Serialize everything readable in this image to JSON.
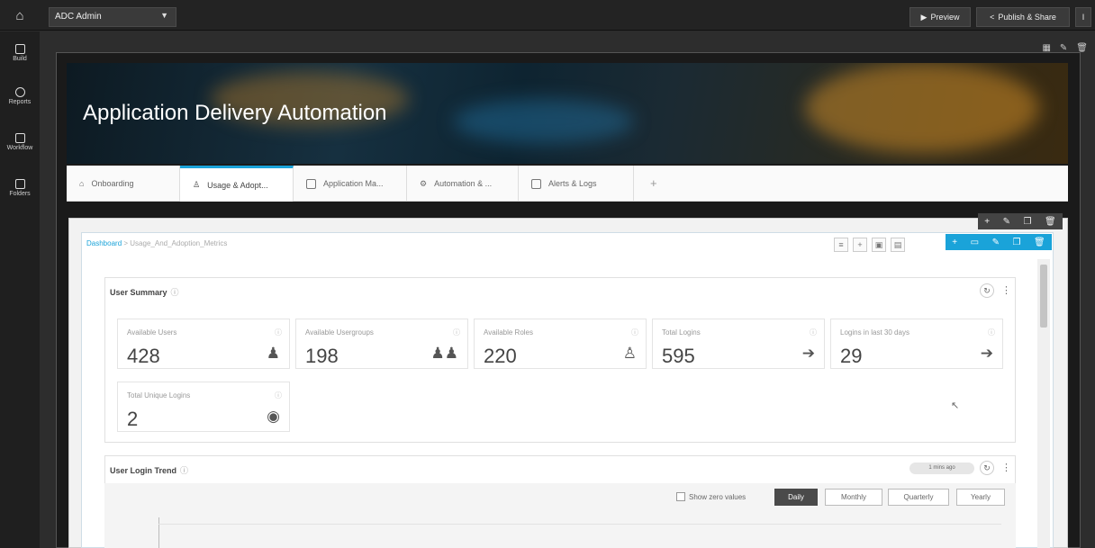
{
  "topbar": {
    "app_name": "ADC Admin",
    "preview_label": "Preview",
    "publish_label": "Publish & Share"
  },
  "sidebar": {
    "items": [
      {
        "label": "Build",
        "icon": "build-icon"
      },
      {
        "label": "Reports",
        "icon": "reports-icon"
      },
      {
        "label": "Workflow",
        "icon": "workflow-icon"
      },
      {
        "label": "Folders",
        "icon": "folder-icon"
      }
    ]
  },
  "banner": {
    "title": "Application Delivery Automation"
  },
  "tabs": [
    {
      "label": "Onboarding",
      "icon": "home-icon"
    },
    {
      "label": "Usage & Adopt...",
      "icon": "user-icon"
    },
    {
      "label": "Application Ma...",
      "icon": "edit-icon"
    },
    {
      "label": "Automation & ...",
      "icon": "gear-icon"
    },
    {
      "label": "Alerts & Logs",
      "icon": "alert-icon"
    }
  ],
  "breadcrumb": {
    "root": "Dashboard",
    "separator": ">",
    "current": "Usage_And_Adoption_Metrics"
  },
  "user_summary": {
    "title": "User Summary",
    "cards": [
      {
        "label": "Available Users",
        "value": "428",
        "icon": "user-icon"
      },
      {
        "label": "Available Usergroups",
        "value": "198",
        "icon": "group-icon"
      },
      {
        "label": "Available Roles",
        "value": "220",
        "icon": "role-icon"
      },
      {
        "label": "Total Logins",
        "value": "595",
        "icon": "arrow-right-circle-icon"
      },
      {
        "label": "Logins in last 30 days",
        "value": "29",
        "icon": "arrow-right-circle-icon"
      },
      {
        "label": "Total Unique Logins",
        "value": "2",
        "icon": "unique-login-icon"
      }
    ]
  },
  "login_trend": {
    "title": "User Login Trend",
    "chip": "1 mins ago",
    "show_zero_label": "Show zero values",
    "toggles": [
      "Daily",
      "Monthly",
      "Quarterly",
      "Yearly"
    ],
    "active_toggle": "Daily"
  }
}
